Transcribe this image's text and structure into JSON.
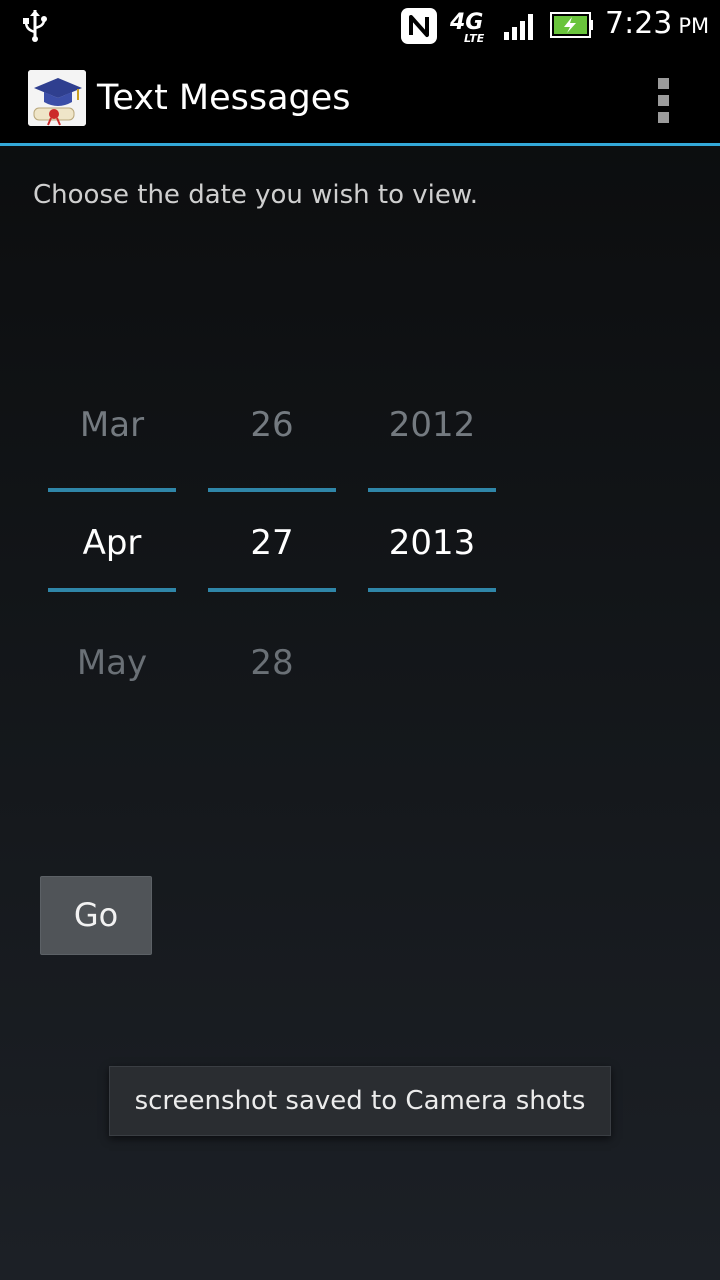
{
  "status_bar": {
    "time": "7:23",
    "ampm": "PM",
    "network_label": "4G",
    "network_sublabel": "LTE",
    "icons": [
      "usb-icon",
      "nfc-icon",
      "signal-icon",
      "battery-charging-icon"
    ]
  },
  "action_bar": {
    "title": "Text Messages",
    "app_icon": "graduation-cap-diploma-icon",
    "menu_icon": "overflow-menu-icon",
    "accent_color": "#33a8d8"
  },
  "prompt": "Choose the date you wish to view.",
  "date_picker": {
    "month": {
      "prev": "Mar",
      "current": "Apr",
      "next": "May"
    },
    "day": {
      "prev": "26",
      "current": "27",
      "next": "28"
    },
    "year": {
      "prev": "2012",
      "current": "2013",
      "next": ""
    }
  },
  "go_button": {
    "label": "Go"
  },
  "toast": {
    "message": "screenshot saved to Camera shots"
  }
}
